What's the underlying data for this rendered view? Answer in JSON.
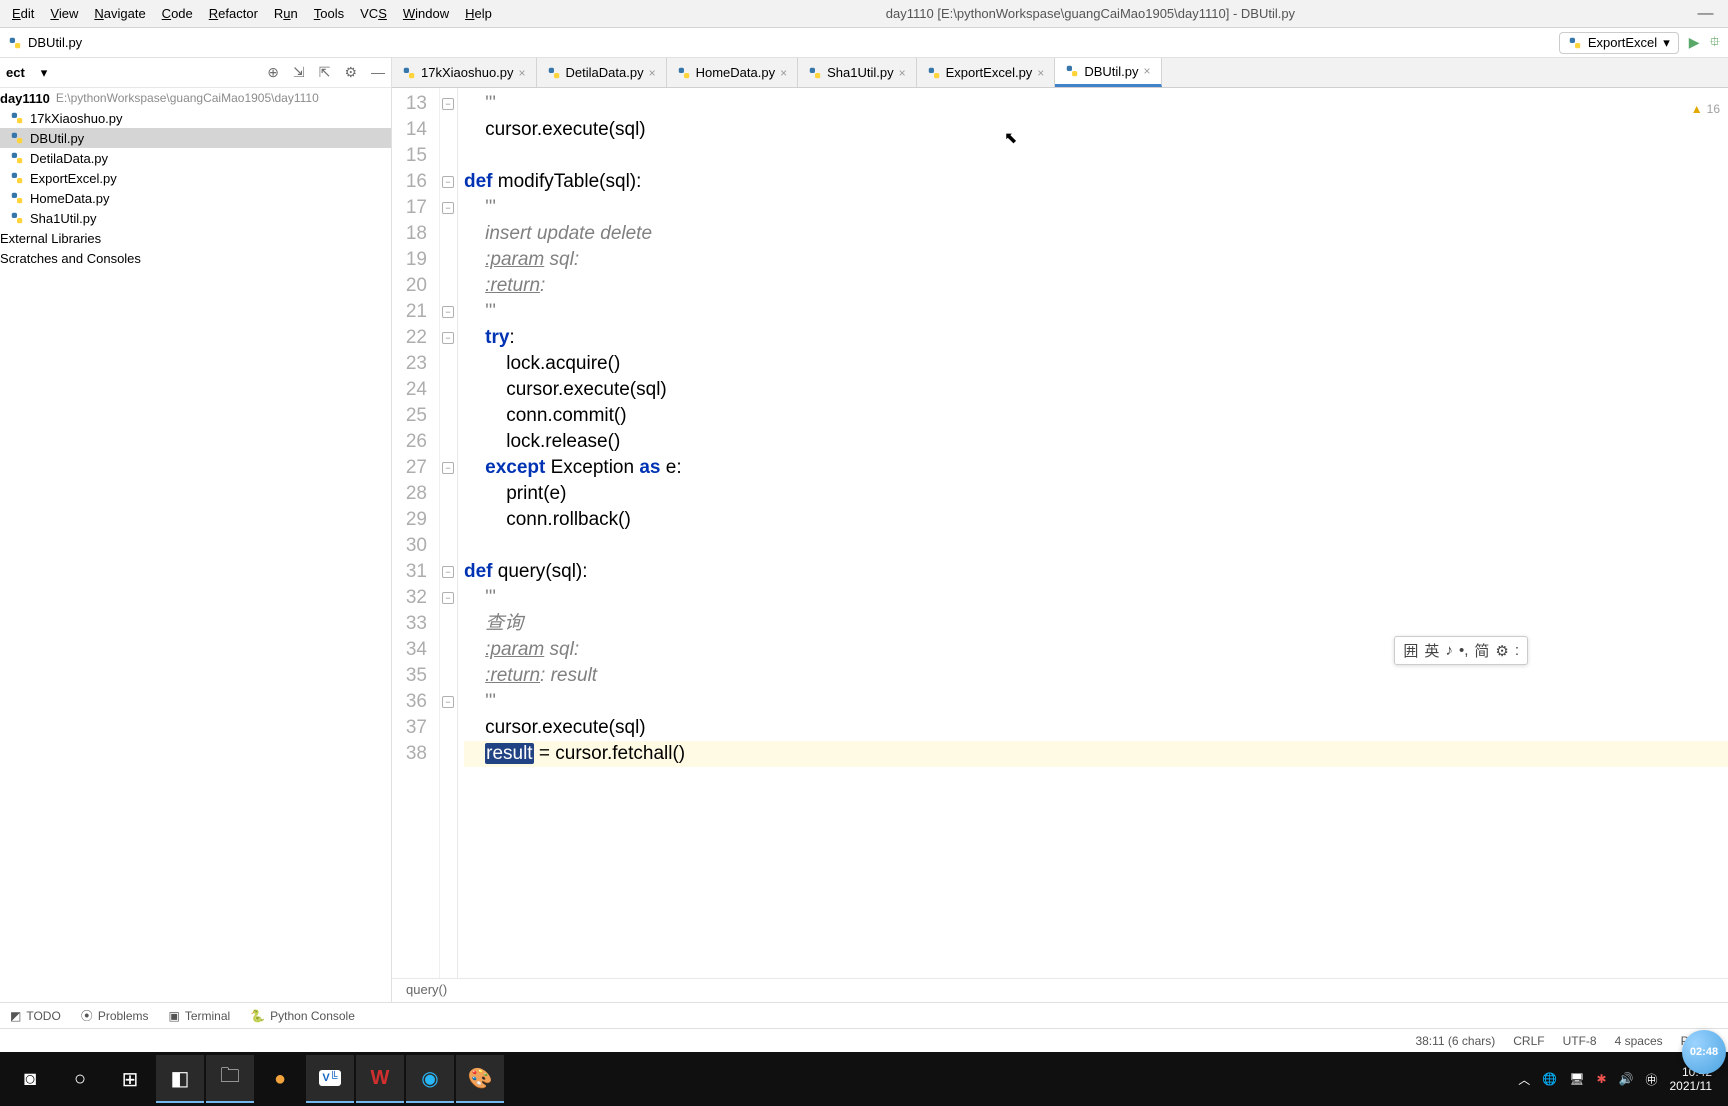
{
  "menu": {
    "items": [
      "Edit",
      "View",
      "Navigate",
      "Code",
      "Refactor",
      "Run",
      "Tools",
      "VCS",
      "Window",
      "Help"
    ]
  },
  "window": {
    "title": "day1110 [E:\\pythonWorkspase\\guangCaiMao1905\\day1110] - DBUtil.py"
  },
  "nav_file": "DBUtil.py",
  "run_config": "ExportExcel",
  "project": {
    "label": "ect",
    "root": {
      "name": "day1110",
      "path": "E:\\pythonWorkspase\\guangCaiMao1905\\day1110"
    },
    "files": [
      "17kXiaoshuo.py",
      "DBUtil.py",
      "DetilaData.py",
      "ExportExcel.py",
      "HomeData.py",
      "Sha1Util.py"
    ],
    "selected": "DBUtil.py",
    "libs": "External Libraries",
    "scratches": "Scratches and Consoles"
  },
  "tabs": [
    {
      "label": "17kXiaoshuo.py",
      "active": false
    },
    {
      "label": "DetilaData.py",
      "active": false
    },
    {
      "label": "HomeData.py",
      "active": false
    },
    {
      "label": "Sha1Util.py",
      "active": false
    },
    {
      "label": "ExportExcel.py",
      "active": false
    },
    {
      "label": "DBUtil.py",
      "active": true
    }
  ],
  "editor": {
    "first_line": 13,
    "breadcrumb": "query()",
    "warnings": "16",
    "lines": [
      {
        "n": 13,
        "html": "    <span class='str'>'''</span>"
      },
      {
        "n": 14,
        "html": "    cursor.execute(sql)"
      },
      {
        "n": 15,
        "html": ""
      },
      {
        "n": 16,
        "html": "<span class='kw2'>def</span> <span class='fn'>modifyTable</span>(sql):"
      },
      {
        "n": 17,
        "html": "    <span class='str'>'''</span>"
      },
      {
        "n": 18,
        "html": "    <span class='doc'>insert update delete</span>"
      },
      {
        "n": 19,
        "html": "    <span class='tag'>:param</span> <span class='doc'>sql:</span>"
      },
      {
        "n": 20,
        "html": "    <span class='tag'>:return</span><span class='doc'>:</span>"
      },
      {
        "n": 21,
        "html": "    <span class='str'>'''</span>"
      },
      {
        "n": 22,
        "html": "    <span class='kw2'>try</span>:"
      },
      {
        "n": 23,
        "html": "        lock.acquire()"
      },
      {
        "n": 24,
        "html": "        cursor.execute(sql)"
      },
      {
        "n": 25,
        "html": "        conn.commit()"
      },
      {
        "n": 26,
        "html": "        lock.release()"
      },
      {
        "n": 27,
        "html": "    <span class='kw2'>except</span> Exception <span class='kw2'>as</span> e:"
      },
      {
        "n": 28,
        "html": "        print(e)"
      },
      {
        "n": 29,
        "html": "        conn.rollback()"
      },
      {
        "n": 30,
        "html": ""
      },
      {
        "n": 31,
        "html": "<span class='kw2'>def</span> <span class='fn'>query</span>(sql):"
      },
      {
        "n": 32,
        "html": "    <span class='str'>'''</span>"
      },
      {
        "n": 33,
        "html": "    <span class='doc'>查询</span>"
      },
      {
        "n": 34,
        "html": "    <span class='tag'>:param</span> <span class='doc'>sql:</span>"
      },
      {
        "n": 35,
        "html": "    <span class='tag'>:return</span><span class='doc'>: result</span>"
      },
      {
        "n": 36,
        "html": "    <span class='str'>'''</span>"
      },
      {
        "n": 37,
        "html": "    cursor.execute(sql)"
      },
      {
        "n": 38,
        "html": "    <span class='sel'>result</span> = cursor.fetchall()",
        "hl": true
      }
    ]
  },
  "ime": {
    "items": [
      "囲",
      "英",
      "♪",
      "•,",
      "简",
      "⚙",
      ":"
    ]
  },
  "toolwin": {
    "items": [
      "TODO",
      "Problems",
      "Terminal",
      "Python Console"
    ]
  },
  "status": {
    "pos": "38:11 (6 chars)",
    "sep": "CRLF",
    "enc": "UTF-8",
    "indent": "4 spaces",
    "lang": "Python"
  },
  "taskbar": {
    "clock_time": "10:42",
    "clock_date": "2021/11",
    "bubble": "02:48"
  }
}
